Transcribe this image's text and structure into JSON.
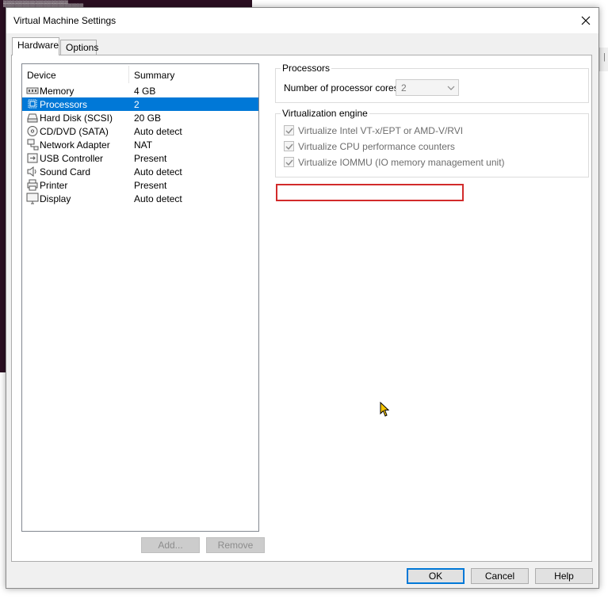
{
  "dialog": {
    "title": "Virtual Machine Settings"
  },
  "tabs": [
    {
      "label": "Hardware",
      "active": true
    },
    {
      "label": "Options",
      "active": false
    }
  ],
  "device_list": {
    "columns": {
      "device": "Device",
      "summary": "Summary"
    },
    "items": [
      {
        "name": "Memory",
        "summary": "4 GB",
        "icon": "memory-icon"
      },
      {
        "name": "Processors",
        "summary": "2",
        "icon": "processor-icon",
        "selected": true
      },
      {
        "name": "Hard Disk (SCSI)",
        "summary": "20 GB",
        "icon": "hard-disk-icon"
      },
      {
        "name": "CD/DVD (SATA)",
        "summary": "Auto detect",
        "icon": "cd-dvd-icon"
      },
      {
        "name": "Network Adapter",
        "summary": "NAT",
        "icon": "network-adapter-icon"
      },
      {
        "name": "USB Controller",
        "summary": "Present",
        "icon": "usb-icon"
      },
      {
        "name": "Sound Card",
        "summary": "Auto detect",
        "icon": "speaker-icon"
      },
      {
        "name": "Printer",
        "summary": "Present",
        "icon": "printer-icon"
      },
      {
        "name": "Display",
        "summary": "Auto detect",
        "icon": "monitor-icon"
      }
    ],
    "add_label": "Add...",
    "remove_label": "Remove"
  },
  "processors": {
    "group_title": "Processors",
    "cores_label": "Number of processor cores:",
    "cores_value": "2"
  },
  "virtualization": {
    "group_title": "Virtualization engine",
    "options": [
      {
        "label": "Virtualize Intel VT-x/EPT or AMD-V/RVI",
        "checked": true
      },
      {
        "label": "Virtualize CPU performance counters",
        "checked": true
      },
      {
        "label": "Virtualize IOMMU (IO memory management unit)",
        "checked": true
      }
    ]
  },
  "footer": {
    "ok_label": "OK",
    "cancel_label": "Cancel",
    "help_label": "Help"
  },
  "colors": {
    "selection": "#0078d7",
    "highlight_box": "#d22b2b",
    "terminal_bg": "#2b0f22"
  }
}
